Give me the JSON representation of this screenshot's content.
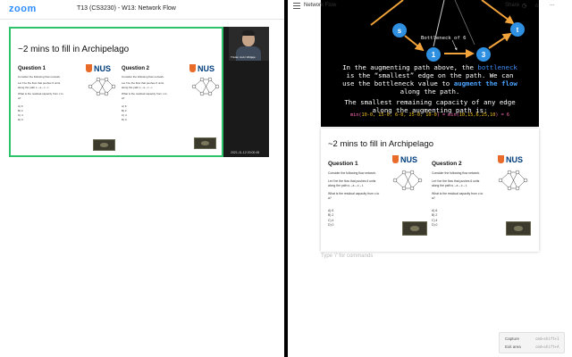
{
  "zoom": {
    "logo": "zoom",
    "title": "T13 (CS3230) - W13: Network Flow",
    "slide": {
      "heading": "~2 mins to fill in Archipelago",
      "q1_title": "Question 1",
      "q2_title": "Question 2",
      "nus_text": "NUS",
      "line1": "Consider the following flow network.",
      "line2": "Let f be the flow that pushes 6 units",
      "line3": "along the path s→a→c→t.",
      "line4": "What is the residual capacity from c to",
      "line5": "a?",
      "opt_a": "A) 6",
      "opt_b": "B) 2",
      "opt_c": "C) 4",
      "opt_d": "D) 0"
    },
    "participant_name": "Tristan Jovin Widjaja",
    "timestamp": "2021-11-12  00:00:45"
  },
  "notion": {
    "page_title": "Network Flow",
    "share_label": "Share",
    "icons": [
      "clock-icon",
      "star-icon",
      "more-icon"
    ],
    "graph": {
      "nodes": [
        "s",
        "1",
        "3",
        "t"
      ],
      "bottleneck_label": "Bottleneck of 6",
      "explanation_lines": [
        [
          "In the augmenting path above, the ",
          "bottleneck",
          ""
        ],
        [
          "is the “smallest” edge on the path. We can",
          "",
          ""
        ],
        [
          "use the bottleneck value to ",
          "augment the flow",
          ""
        ],
        [
          "along the path.",
          "",
          ""
        ]
      ],
      "explanation2_lines": [
        "The smallest remaining capacity of any edge",
        "along the augmenting path is:"
      ],
      "formula_left": "min(",
      "formula_mid1": "10-0, 15-0, 6-0, 25-0, 10-0",
      "formula_eq": ") = ",
      "formula_right": "min(",
      "formula_mid2": "10,15,6,25,10",
      "formula_end": ") = 6"
    },
    "slide": {
      "heading": "~2 mins to fill in Archipelago",
      "q1_title": "Question 1",
      "q2_title": "Question 2",
      "nus_text": "NUS",
      "line1": "Consider the following flow network.",
      "line2": "Let f be the flow that pushes 6 units",
      "line3": "along the path s→a→c→t.",
      "line4": "What is the residual capacity from c to",
      "line5": "a?",
      "opt_a": "A) 6",
      "opt_b": "B) 2",
      "opt_c": "C) 4",
      "opt_d": "D) 0"
    },
    "placeholder": "Type '/' for commands",
    "capture_popup": {
      "capture_label": "Capture",
      "capture_key": "cmd+shift+1",
      "exit_label": "Exit area",
      "exit_key": "cmd+shift+A"
    }
  },
  "colors": {
    "zoom_blue": "#2d8cff",
    "share_green": "#2cc36b",
    "node_blue": "#2f8fe0",
    "edge_orange": "#f2a33a",
    "formula_yellow": "#f0c020",
    "highlight_blue": "#3d8df5"
  }
}
